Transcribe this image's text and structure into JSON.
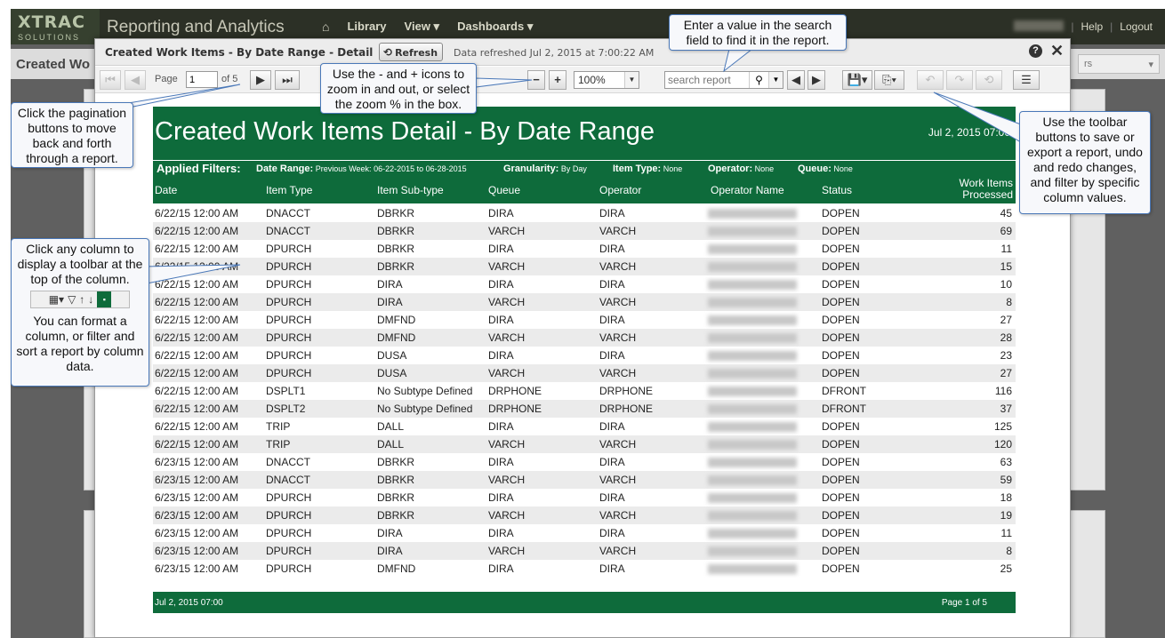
{
  "topbar": {
    "logo_main": "XTRAC",
    "logo_sub": "SOLUTIONS",
    "app_title": "Reporting and Analytics",
    "nav": [
      "Library",
      "View",
      "Dashboards"
    ],
    "help": "Help",
    "logout": "Logout"
  },
  "background": {
    "page_title": "Created Wo",
    "select_text": "rs"
  },
  "dialog": {
    "title": "Created Work Items - By Date Range - Detail",
    "refresh_label": "Refresh",
    "refreshed_text": "Data refreshed Jul 2, 2015 at 7:00:22 AM"
  },
  "toolbar": {
    "page_label": "Page",
    "page_value": "1",
    "of_label": "of 5",
    "zoom_value": "100%",
    "search_placeholder": "search report"
  },
  "report": {
    "title": "Created Work Items Detail - By Date Range",
    "date": "Jul 2, 2015 07:00",
    "filters_lead": "Applied Filters:",
    "filters": [
      {
        "label": "Date Range:",
        "value": "Previous Week: 06-22-2015 to 06-28-2015"
      },
      {
        "label": "Granularity:",
        "value": "By Day"
      },
      {
        "label": "Item Type:",
        "value": "None"
      },
      {
        "label": "Operator:",
        "value": "None"
      },
      {
        "label": "Queue:",
        "value": "None"
      }
    ],
    "columns": [
      "Date",
      "Item Type",
      "Item Sub-type",
      "Queue",
      "Operator",
      "Operator Name",
      "Status",
      "Work Items",
      "Processed"
    ],
    "rows": [
      [
        "6/22/15 12:00 AM",
        "DNACCT",
        "DBRKR",
        "DIRA",
        "DIRA",
        "DOPEN",
        "45"
      ],
      [
        "6/22/15 12:00 AM",
        "DNACCT",
        "DBRKR",
        "VARCH",
        "VARCH",
        "DOPEN",
        "69"
      ],
      [
        "6/22/15 12:00 AM",
        "DPURCH",
        "DBRKR",
        "DIRA",
        "DIRA",
        "DOPEN",
        "11"
      ],
      [
        "6/22/15 12:00 AM",
        "DPURCH",
        "DBRKR",
        "VARCH",
        "VARCH",
        "DOPEN",
        "15"
      ],
      [
        "6/22/15 12:00 AM",
        "DPURCH",
        "DIRA",
        "DIRA",
        "DIRA",
        "DOPEN",
        "10"
      ],
      [
        "6/22/15 12:00 AM",
        "DPURCH",
        "DIRA",
        "VARCH",
        "VARCH",
        "DOPEN",
        "8"
      ],
      [
        "6/22/15 12:00 AM",
        "DPURCH",
        "DMFND",
        "DIRA",
        "DIRA",
        "DOPEN",
        "27"
      ],
      [
        "6/22/15 12:00 AM",
        "DPURCH",
        "DMFND",
        "VARCH",
        "VARCH",
        "DOPEN",
        "28"
      ],
      [
        "6/22/15 12:00 AM",
        "DPURCH",
        "DUSA",
        "DIRA",
        "DIRA",
        "DOPEN",
        "23"
      ],
      [
        "6/22/15 12:00 AM",
        "DPURCH",
        "DUSA",
        "VARCH",
        "VARCH",
        "DOPEN",
        "27"
      ],
      [
        "6/22/15 12:00 AM",
        "DSPLT1",
        "No Subtype Defined",
        "DRPHONE",
        "DRPHONE",
        "DFRONT",
        "116"
      ],
      [
        "6/22/15 12:00 AM",
        "DSPLT2",
        "No Subtype Defined",
        "DRPHONE",
        "DRPHONE",
        "DFRONT",
        "37"
      ],
      [
        "6/22/15 12:00 AM",
        "TRIP",
        "DALL",
        "DIRA",
        "DIRA",
        "DOPEN",
        "125"
      ],
      [
        "6/22/15 12:00 AM",
        "TRIP",
        "DALL",
        "VARCH",
        "VARCH",
        "DOPEN",
        "120"
      ],
      [
        "6/23/15 12:00 AM",
        "DNACCT",
        "DBRKR",
        "DIRA",
        "DIRA",
        "DOPEN",
        "63"
      ],
      [
        "6/23/15 12:00 AM",
        "DNACCT",
        "DBRKR",
        "VARCH",
        "VARCH",
        "DOPEN",
        "59"
      ],
      [
        "6/23/15 12:00 AM",
        "DPURCH",
        "DBRKR",
        "DIRA",
        "DIRA",
        "DOPEN",
        "18"
      ],
      [
        "6/23/15 12:00 AM",
        "DPURCH",
        "DBRKR",
        "VARCH",
        "VARCH",
        "DOPEN",
        "19"
      ],
      [
        "6/23/15 12:00 AM",
        "DPURCH",
        "DIRA",
        "DIRA",
        "DIRA",
        "DOPEN",
        "11"
      ],
      [
        "6/23/15 12:00 AM",
        "DPURCH",
        "DIRA",
        "VARCH",
        "VARCH",
        "DOPEN",
        "8"
      ],
      [
        "6/23/15 12:00 AM",
        "DPURCH",
        "DMFND",
        "DIRA",
        "DIRA",
        "DOPEN",
        "25"
      ]
    ],
    "footer_left": "Jul 2, 2015 07:00",
    "footer_right": "Page 1 of 5"
  },
  "callouts": {
    "search": "Enter a value in the search field to find it in the report.",
    "zoom": "Use the - and + icons to zoom in and out, or select the zoom % in the box.",
    "pagination": "Click the pagination buttons to move back and forth through a report.",
    "column_top": "Click any column to display a toolbar at the top of the column.",
    "column_bottom": "You can format a column, or filter and sort a report by column data.",
    "toolbar": "Use the toolbar buttons to save or export a report, undo and redo changes, and filter by specific column values."
  },
  "colors": {
    "report_green": "#0e6b3b",
    "topbar": "#2c3026",
    "callout_border": "#4a78b8"
  }
}
